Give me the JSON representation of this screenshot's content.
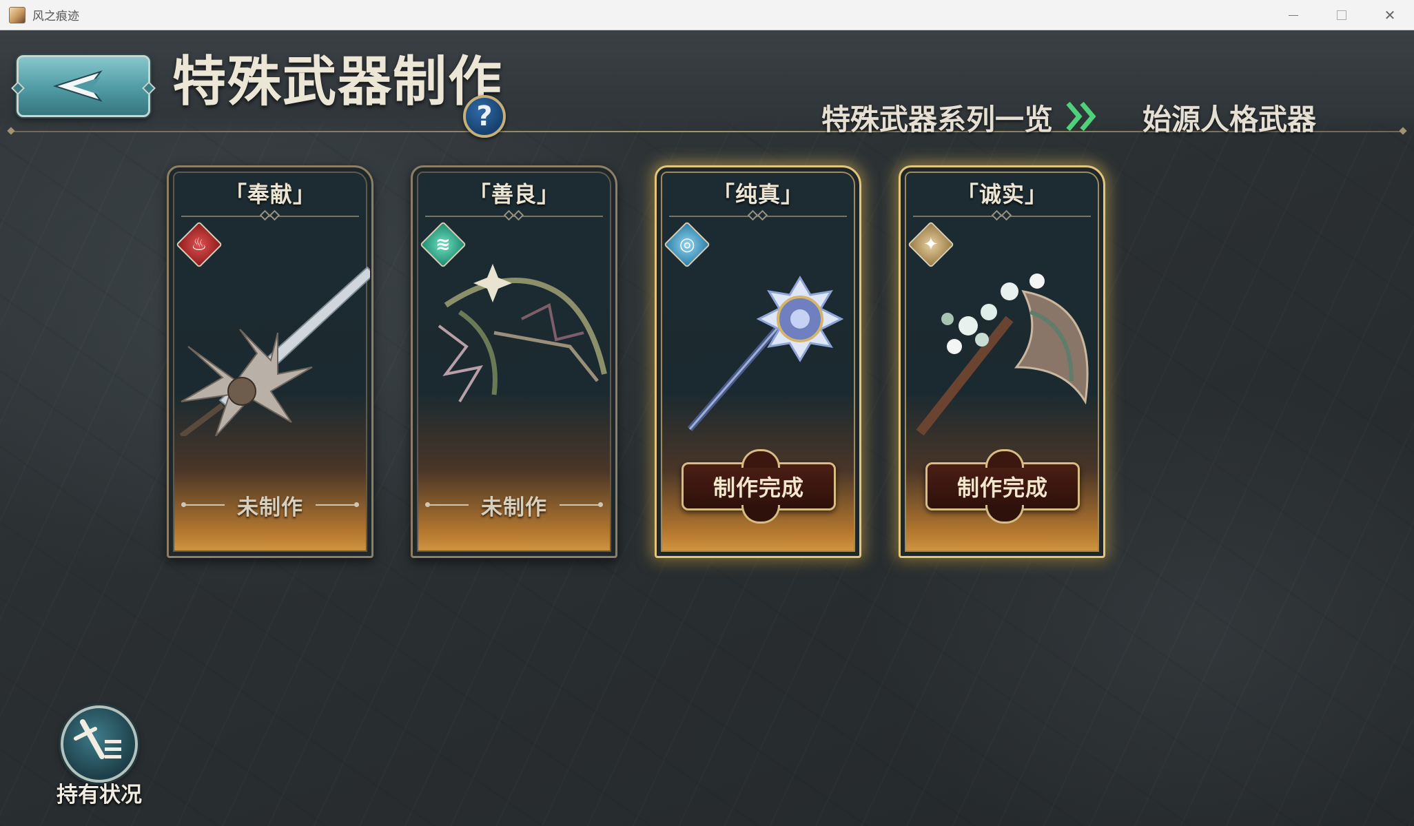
{
  "window": {
    "title": "风之痕迹",
    "controls": {
      "minimize": "—",
      "maximize": "",
      "close": "✕"
    }
  },
  "header": {
    "title": "特殊武器制作",
    "help_label": "?",
    "nav_series": "特殊武器系列一览",
    "nav_origin": "始源人格武器"
  },
  "cards": [
    {
      "name": "「奉献」",
      "element": "fire-icon",
      "element_color": "#c23a3a",
      "status": "未制作",
      "crafted": false
    },
    {
      "name": "「善良」",
      "element": "wind-icon",
      "element_color": "#2fb08f",
      "status": "未制作",
      "crafted": false
    },
    {
      "name": "「纯真」",
      "element": "water-icon",
      "element_color": "#4aa3cf",
      "status": "制作完成",
      "crafted": true
    },
    {
      "name": "「诚实」",
      "element": "earth-icon",
      "element_color": "#b8965a",
      "status": "制作完成",
      "crafted": true
    }
  ],
  "holdings": {
    "label": "持有状况"
  },
  "colors": {
    "background": "#2a2e30",
    "gold_accent": "#d7bd84",
    "teal_button": "#4f9aa3",
    "crafted_badge": "#3b170f"
  }
}
